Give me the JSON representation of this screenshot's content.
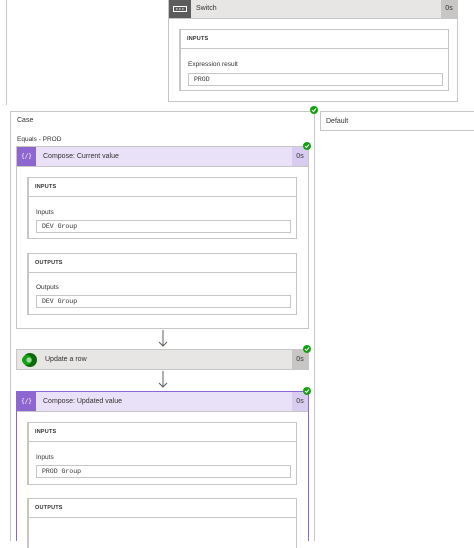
{
  "switch": {
    "title": "Switch",
    "duration": "0s",
    "inputs_label": "INPUTS",
    "expression_label": "Expression result",
    "expression_value": "PROD"
  },
  "case": {
    "title": "Case",
    "condition": "Equals - PROD"
  },
  "default": {
    "title": "Default"
  },
  "compose_current": {
    "title": "Compose: Current value",
    "duration": "0s",
    "inputs_section": "INPUTS",
    "inputs_label": "Inputs",
    "inputs_value": "DEV Group",
    "outputs_section": "OUTPUTS",
    "outputs_label": "Outputs",
    "outputs_value": "DEV Group"
  },
  "update_row": {
    "title": "Update a row",
    "duration": "0s"
  },
  "compose_updated": {
    "title": "Compose: Updated value",
    "duration": "0s",
    "inputs_section": "INPUTS",
    "inputs_label": "Inputs",
    "inputs_value": "PROD Group",
    "outputs_section": "OUTPUTS"
  },
  "icons": {
    "switch": "switch-icon",
    "compose": "compose-braces-icon",
    "dataverse": "dataverse-icon",
    "success": "success-check-icon",
    "arrow": "arrow-down-icon"
  },
  "colors": {
    "compose_accent": "#8e66d1",
    "compose_header": "#e8e1f7",
    "success": "#13a10e",
    "switch_header": "#e7e6e5",
    "switch_icon": "#5c5c5c"
  }
}
